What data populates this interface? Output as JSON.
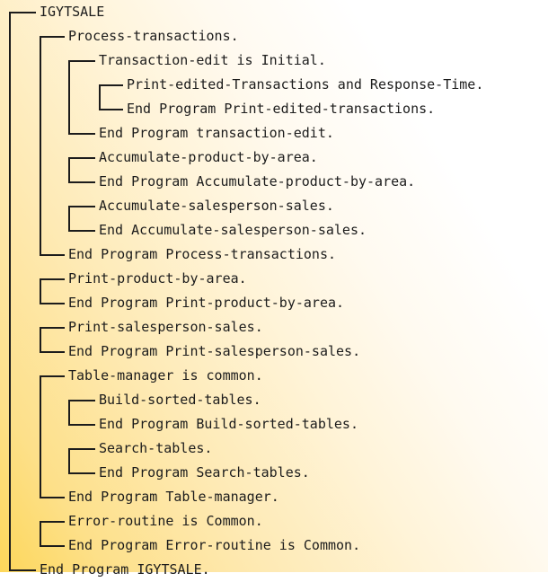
{
  "tree": {
    "lines": [
      {
        "text": "IGYTSALE",
        "level": 0
      },
      {
        "text": "Process-transactions.",
        "level": 1
      },
      {
        "text": "Transaction-edit is Initial.",
        "level": 2
      },
      {
        "text": "Print-edited-Transactions and Response-Time.",
        "level": 3
      },
      {
        "text": "End Program Print-edited-transactions.",
        "level": 3
      },
      {
        "text": "End Program transaction-edit.",
        "level": 2
      },
      {
        "text": "Accumulate-product-by-area.",
        "level": 2
      },
      {
        "text": "End Program Accumulate-product-by-area.",
        "level": 2
      },
      {
        "text": "Accumulate-salesperson-sales.",
        "level": 2
      },
      {
        "text": "End Accumulate-salesperson-sales.",
        "level": 2
      },
      {
        "text": "End Program Process-transactions.",
        "level": 1
      },
      {
        "text": "Print-product-by-area.",
        "level": 1
      },
      {
        "text": "End Program Print-product-by-area.",
        "level": 1
      },
      {
        "text": "Print-salesperson-sales.",
        "level": 1
      },
      {
        "text": "End Program Print-salesperson-sales.",
        "level": 1
      },
      {
        "text": "Table-manager is common.",
        "level": 1
      },
      {
        "text": "Build-sorted-tables.",
        "level": 2
      },
      {
        "text": "End Program Build-sorted-tables.",
        "level": 2
      },
      {
        "text": "Search-tables.",
        "level": 2
      },
      {
        "text": "End Program Search-tables.",
        "level": 2
      },
      {
        "text": "End Program Table-manager.",
        "level": 1
      },
      {
        "text": "Error-routine is Common.",
        "level": 1
      },
      {
        "text": "End Program Error-routine is Common.",
        "level": 1
      },
      {
        "text": "End Program IGYTSALE.",
        "level": 0
      }
    ],
    "brackets": [
      [
        0,
        23
      ],
      [
        1,
        10
      ],
      [
        2,
        5
      ],
      [
        3,
        4
      ],
      [
        6,
        7
      ],
      [
        8,
        9
      ],
      [
        11,
        12
      ],
      [
        13,
        14
      ],
      [
        15,
        20
      ],
      [
        16,
        17
      ],
      [
        18,
        19
      ],
      [
        21,
        22
      ]
    ]
  }
}
